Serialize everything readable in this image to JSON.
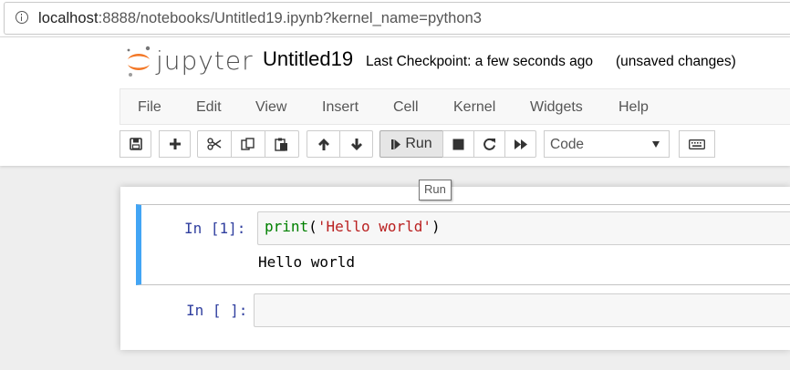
{
  "browser": {
    "url_host": "localhost",
    "url_rest": ":8888/notebooks/Untitled19.ipynb?kernel_name=python3"
  },
  "header": {
    "logo_text": "jupyter",
    "notebook_title": "Untitled19",
    "checkpoint_label": "Last Checkpoint:",
    "checkpoint_time": "a few seconds ago",
    "save_status": "(unsaved changes)"
  },
  "menu": {
    "items": [
      "File",
      "Edit",
      "View",
      "Insert",
      "Cell",
      "Kernel",
      "Widgets",
      "Help"
    ]
  },
  "toolbar": {
    "run_label": "Run",
    "cell_type": "Code",
    "icons": [
      "save-icon",
      "plus-icon",
      "cut-icon",
      "copy-icon",
      "paste-icon",
      "arrow-up-icon",
      "arrow-down-icon",
      "step-forward-icon",
      "stop-icon",
      "restart-icon",
      "fast-forward-icon",
      "keyboard-icon"
    ]
  },
  "tooltip": {
    "text": "Run"
  },
  "cells": [
    {
      "prompt": "In [1]:",
      "code_func": "print",
      "code_open": "(",
      "code_str": "'Hello world'",
      "code_close": ")",
      "output": "Hello world"
    },
    {
      "prompt": "In [ ]:",
      "code": ""
    }
  ],
  "colors": {
    "selected_cell_border": "#42a5f5",
    "prompt": "#303f9f",
    "code_string": "#ba2121",
    "code_builtin": "#008000",
    "logo_orange": "#f37726"
  }
}
